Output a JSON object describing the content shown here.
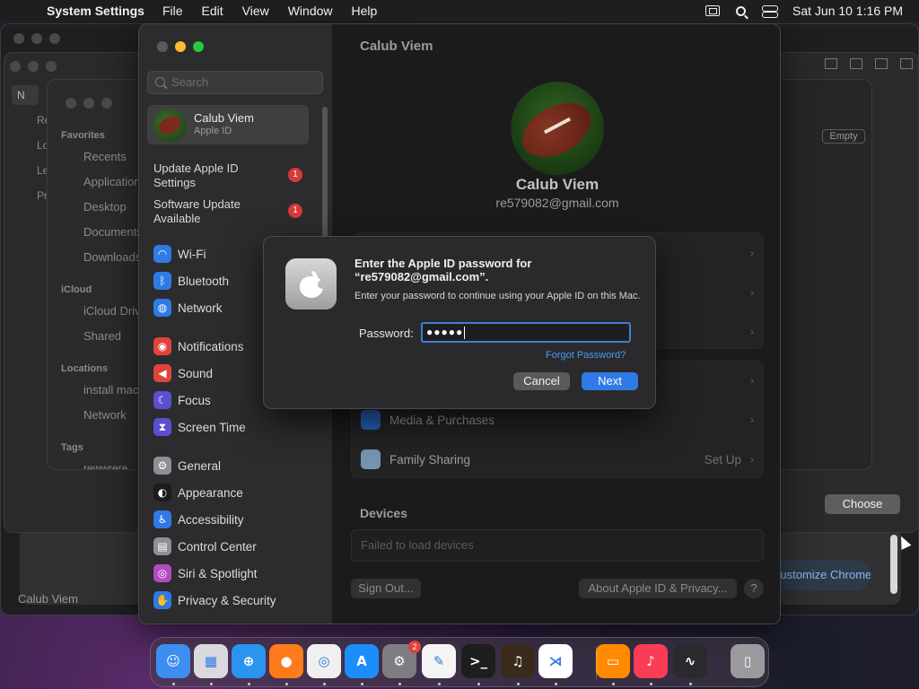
{
  "menubar": {
    "apple": "",
    "app_name": "System Settings",
    "items": [
      "File",
      "Edit",
      "View",
      "Window",
      "Help"
    ],
    "clock": "Sat Jun 10  1:16 PM"
  },
  "finder": {
    "favorites_label": "Favorites",
    "favorites": [
      "Recents",
      "Applications",
      "Desktop",
      "Documents",
      "Downloads"
    ],
    "icloud_label": "iCloud",
    "icloud": [
      "iCloud Drive",
      "Shared"
    ],
    "locations_label": "Locations",
    "locations": [
      "install macOS",
      "Network"
    ],
    "tags_label": "Tags",
    "tags_item": "rewwrere"
  },
  "background": {
    "empty_badge": "Empty",
    "choose": "Choose",
    "customize_chrome": "Customize Chrome",
    "bottom_user": "Calub Viem",
    "left_partial": [
      "N",
      "Re",
      "Lo",
      "Le",
      "Pr"
    ]
  },
  "settings": {
    "search_placeholder": "Search",
    "account": {
      "name": "Calub Viem",
      "sub": "Apple ID"
    },
    "notices": [
      {
        "label": "Update Apple ID Settings",
        "badge": "1"
      },
      {
        "label": "Software Update Available",
        "badge": "1"
      }
    ],
    "nav": [
      {
        "label": "Wi-Fi",
        "icon": "wifi-icon",
        "color": "#2f7ae5",
        "glyph": "◠"
      },
      {
        "label": "Bluetooth",
        "icon": "bluetooth-icon",
        "color": "#2f7ae5",
        "glyph": "ᛒ"
      },
      {
        "label": "Network",
        "icon": "globe-icon",
        "color": "#2f7ae5",
        "glyph": "◍"
      },
      {
        "label": "Notifications",
        "icon": "bell-icon",
        "color": "#e0433a",
        "glyph": "◉"
      },
      {
        "label": "Sound",
        "icon": "speaker-icon",
        "color": "#e0433a",
        "glyph": "◀"
      },
      {
        "label": "Focus",
        "icon": "moon-icon",
        "color": "#5a4fcf",
        "glyph": "☾"
      },
      {
        "label": "Screen Time",
        "icon": "hourglass-icon",
        "color": "#5a4fcf",
        "glyph": "⧗"
      },
      {
        "label": "General",
        "icon": "gear-icon",
        "color": "#8e8e93",
        "glyph": "⚙"
      },
      {
        "label": "Appearance",
        "icon": "appearance-icon",
        "color": "#1c1c1e",
        "glyph": "◐"
      },
      {
        "label": "Accessibility",
        "icon": "accessibility-icon",
        "color": "#2f7ae5",
        "glyph": "♿"
      },
      {
        "label": "Control Center",
        "icon": "control-center-icon",
        "color": "#8e8e93",
        "glyph": "▤"
      },
      {
        "label": "Siri & Spotlight",
        "icon": "siri-icon",
        "color": "#b04cc0",
        "glyph": "◎"
      },
      {
        "label": "Privacy & Security",
        "icon": "hand-icon",
        "color": "#2f7ae5",
        "glyph": "✋"
      }
    ],
    "main": {
      "title": "Calub Viem",
      "name": "Calub Viem",
      "email": "re579082@gmail.com",
      "media": "Media & Purchases",
      "family": "Family Sharing",
      "family_value": "Set Up",
      "devices_heading": "Devices",
      "devices_error": "Failed to load devices",
      "sign_out": "Sign Out...",
      "about": "About Apple ID & Privacy...",
      "help": "?"
    }
  },
  "dialog": {
    "title": "Enter the Apple ID password for “re579082@gmail.com”.",
    "description": "Enter your password to continue using your Apple ID on this Mac.",
    "password_label": "Password:",
    "password_value": "●●●●●",
    "forgot": "Forgot Password?",
    "cancel": "Cancel",
    "next": "Next"
  },
  "dock": {
    "badge": "2",
    "items": [
      {
        "name": "finder",
        "icon": "finder-icon",
        "color": "#3d8ef0",
        "glyph": "☺"
      },
      {
        "name": "launchpad",
        "icon": "launchpad-icon",
        "color": "#d9d9de",
        "glyph": "▦"
      },
      {
        "name": "safari",
        "icon": "safari-icon",
        "color": "#2b93f0",
        "glyph": "⊕"
      },
      {
        "name": "firefox",
        "icon": "firefox-icon",
        "color": "#ff7a1a",
        "glyph": "●"
      },
      {
        "name": "chrome",
        "icon": "chrome-icon",
        "color": "#f0f0f0",
        "glyph": "◎"
      },
      {
        "name": "app-store",
        "icon": "app-store-icon",
        "color": "#1c8ef9",
        "glyph": "A"
      },
      {
        "name": "system-settings",
        "icon": "system-settings-icon",
        "color": "#7d7d82",
        "glyph": "⚙"
      },
      {
        "name": "textedit",
        "icon": "textedit-icon",
        "color": "#f4f4f4",
        "glyph": "✎"
      },
      {
        "name": "terminal",
        "icon": "terminal-icon",
        "color": "#1e1e1e",
        "glyph": ">_"
      },
      {
        "name": "garageband",
        "icon": "guitar-icon",
        "color": "#3a2a1c",
        "glyph": "♫"
      },
      {
        "name": "vscode",
        "icon": "vscode-icon",
        "color": "#ffffff",
        "glyph": "⋊"
      },
      {
        "name": "books",
        "icon": "books-icon",
        "color": "#ff8a00",
        "glyph": "▭"
      },
      {
        "name": "music",
        "icon": "music-icon",
        "color": "#fa3c56",
        "glyph": "♪"
      },
      {
        "name": "activity-monitor",
        "icon": "activity-monitor-icon",
        "color": "#2a2a2e",
        "glyph": "∿"
      },
      {
        "name": "trash",
        "icon": "trash-icon",
        "color": "#9a9a9e",
        "glyph": "▯"
      }
    ]
  }
}
